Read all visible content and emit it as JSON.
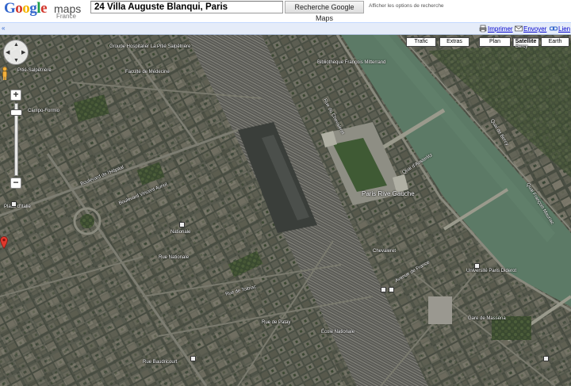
{
  "header": {
    "logo_google": "Google",
    "logo_maps": "maps",
    "logo_country": "France",
    "search_value": "24 Villa Auguste Blanqui, Paris",
    "search_button": "Recherche Google Maps",
    "options_link": "Afficher les options de recherche"
  },
  "linkbar": {
    "collapse_icon": "«",
    "print": "Imprimer",
    "send": "Envoyer",
    "link": "Lien"
  },
  "map_types": [
    "Trafic",
    "Extras",
    "Plan",
    "Satellite",
    "Earth"
  ],
  "map_types_active": "Satellite",
  "labels": {
    "hopital": "Groupe Hospitalier La Pitié Salpêtrière",
    "faculte": "Faculté de Médecine",
    "boulevard_hopital": "Boulevard de l'Hôpital",
    "pitie": "Pitié-Salpêtrière",
    "campo": "Campo-Formio",
    "nationale": "Nationale",
    "paris_rive_gauche": "Paris Rive Gauche",
    "bibliotheque": "Bibliothèque François Mitterrand",
    "quai_austerlitz": "Quai d'Austerlitz",
    "quai_bercy": "Quai de Bercy",
    "rue_tolbiac": "Rue de Tolbiac",
    "place_italie": "Place d'Italie",
    "bd_vincent_auriol": "Boulevard Vincent Auriol",
    "rue_chevaleret": "Rue du Chevaleret",
    "rue_patay": "Rue de Patay",
    "chevaleret": "Chevaleret",
    "av_france": "Avenue de France",
    "universite": "Université Paris Diderot",
    "gare_masse": "Gare de Masséna",
    "rue_baudricourt": "Rue Baudricourt",
    "ecole": "École Nationale",
    "rue_nationale": "Rue Nationale",
    "bercy": "Bercy",
    "quai_france": "Quai François Mauriac"
  },
  "icons": {
    "pan": "pan-control-icon",
    "pegman": "pegman-icon",
    "zoom_in": "zoom-in-icon",
    "zoom_out": "zoom-out-icon",
    "pin": "location-pin-icon",
    "print": "printer-icon",
    "send": "envelope-icon",
    "link": "link-icon"
  },
  "colors": {
    "brand_blue": "#3366cc",
    "linkbar_bg": "#e5ecf9",
    "river": "#5c7a66",
    "pin_red": "#e0382c"
  }
}
